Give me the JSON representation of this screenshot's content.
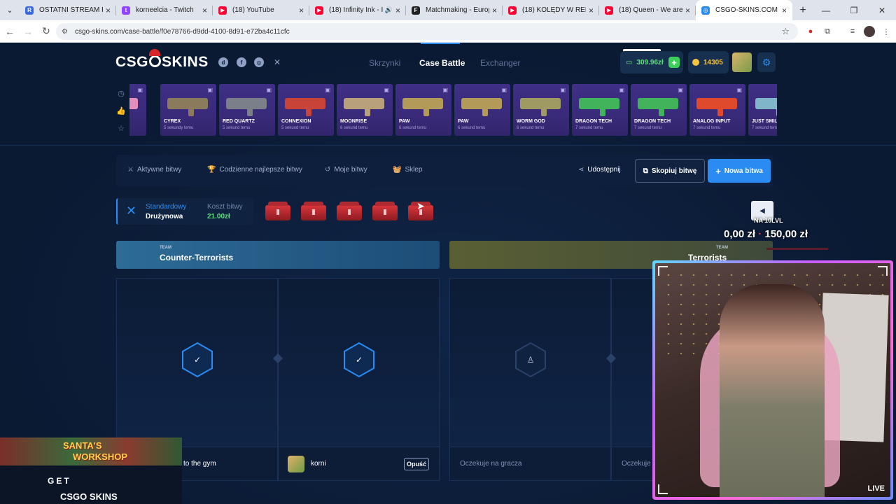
{
  "browser": {
    "tabs": [
      {
        "label": "OSTATNI STREAM PRZED",
        "favicon_color": "#3c6be0",
        "favicon_glyph": "R"
      },
      {
        "label": "korneelcia - Twitch",
        "favicon_color": "#9146ff",
        "favicon_glyph": "t"
      },
      {
        "label": "(18) YouTube",
        "favicon_color": "#ff0033",
        "favicon_glyph": "▶"
      },
      {
        "label": "(18) Infinity Ink - Infin",
        "favicon_color": "#ff0033",
        "favicon_glyph": "▶",
        "audio": "speaker-icon"
      },
      {
        "label": "Matchmaking - Europe 5",
        "favicon_color": "#222222",
        "favicon_glyph": "F"
      },
      {
        "label": "(18) KOLĘDY W REMIXAC",
        "favicon_color": "#ff0033",
        "favicon_glyph": "▶"
      },
      {
        "label": "(18) Queen - We are the c",
        "favicon_color": "#ff0033",
        "favicon_glyph": "▶"
      },
      {
        "label": "CSGO-SKINS.COM - Najle",
        "favicon_color": "#2a8bf2",
        "favicon_glyph": "◎",
        "active": true
      }
    ],
    "url": "csgo-skins.com/case-battle/f0e78766-d9dd-4100-8d91-e72ba4c11cfc"
  },
  "site": {
    "logo": {
      "left": "CSG",
      "right": "SKINS"
    },
    "socials": [
      "discord-icon",
      "facebook-icon",
      "instagram-icon",
      "x-icon"
    ],
    "nav": {
      "cases": "Skrzynki",
      "battle": "Case Battle",
      "exchanger": "Exchanger"
    },
    "balance": "309.96zł",
    "coins": "14305",
    "drops": [
      {
        "name": "",
        "time": "temu",
        "color": "#e58fbf"
      },
      {
        "name": "CYREX",
        "time": "5 sekundy temu",
        "color": "#8b7b5c"
      },
      {
        "name": "RED QUARTZ",
        "time": "5 sekund temu",
        "color": "#7a7f8a"
      },
      {
        "name": "CONNEXION",
        "time": "5 sekund temu",
        "color": "#c94438"
      },
      {
        "name": "MOONRISE",
        "time": "6 sekund temu",
        "color": "#b8a07a"
      },
      {
        "name": "PAW",
        "time": "6 sekund temu",
        "color": "#b39a58"
      },
      {
        "name": "PAW",
        "time": "6 sekund temu",
        "color": "#b39a58"
      },
      {
        "name": "WORM GOD",
        "time": "6 sekund temu",
        "color": "#9f9a62"
      },
      {
        "name": "DRAGON TECH",
        "time": "7 sekund temu",
        "color": "#41b35a"
      },
      {
        "name": "DRAGON TECH",
        "time": "7 sekund temu",
        "color": "#41b35a"
      },
      {
        "name": "ANALOG INPUT",
        "time": "7 sekund temu",
        "color": "#e04a2c"
      },
      {
        "name": "JUST SMIL",
        "time": "7 sekund temu",
        "color": "#7fb6c9"
      }
    ],
    "toolbar": {
      "active_battles": "Aktywne bitwy",
      "daily_best": "Codzienne najlepsze bitwy",
      "my_battles": "Moje bitwy",
      "shop": "Sklep",
      "share": "Udostępnij",
      "copy": "Skopiuj bitwę",
      "new": "Nowa bitwa"
    },
    "battle": {
      "mode": "Standardowy",
      "type": "Drużynowa",
      "cost_label": "Koszt bitwy",
      "cost": "21.00zł",
      "cases_count": 5
    },
    "teams": {
      "label": "TEAM",
      "ct": "Counter-Terrorists",
      "t": "Terrorists"
    },
    "slots": [
      {
        "name": "to the gym",
        "status": "ready"
      },
      {
        "name": "korni",
        "status": "ready",
        "action": "Opuść"
      },
      {
        "name": "Oczekuje na gracza",
        "status": "waiting"
      },
      {
        "name": "Oczekuje n",
        "status": "waiting"
      }
    ]
  },
  "overlay": {
    "prize_level": "NA 10LVL",
    "prize_amount_from": "0,00 zł",
    "prize_amount_to": "150,00 zł",
    "live": "LIVE",
    "promo": {
      "line1": "SANTA'S",
      "line2": "WORKSHOP",
      "get": "GET",
      "brand": "CSGO SKINS"
    }
  }
}
